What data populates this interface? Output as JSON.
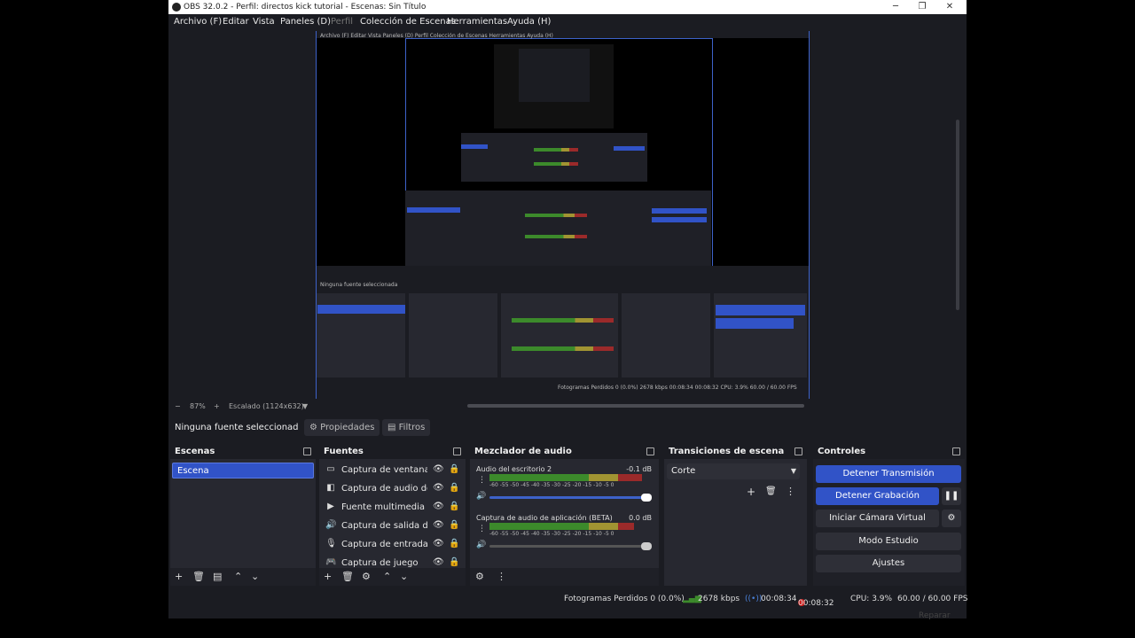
{
  "window": {
    "title": "OBS 32.0.2 - Perfil: directos kick tutorial - Escenas: Sin Título"
  },
  "menu": [
    {
      "label": "Archivo (F)",
      "enabled": true
    },
    {
      "label": "Editar",
      "enabled": true
    },
    {
      "label": "Vista",
      "enabled": true
    },
    {
      "label": "Paneles (D)",
      "enabled": true
    },
    {
      "label": "Perfil",
      "enabled": false
    },
    {
      "label": "Colección de Escenas",
      "enabled": true
    },
    {
      "label": "Herramientas",
      "enabled": true
    },
    {
      "label": "Ayuda (H)",
      "enabled": true
    }
  ],
  "zoombar": {
    "zoom": "87%",
    "scale": "Escalado (1124x632)"
  },
  "propbar": {
    "source_label": "Ninguna fuente seleccionad",
    "properties": "Propiedades",
    "filters": "Filtros"
  },
  "docks": {
    "scenes": {
      "title": "Escenas",
      "items": [
        "Escena"
      ]
    },
    "sources": {
      "title": "Fuentes",
      "items": [
        {
          "icon": "window-icon",
          "label": "Captura de ventana"
        },
        {
          "icon": "audio-input-icon",
          "label": "Captura de audio de aplicación"
        },
        {
          "icon": "play-icon",
          "label": "Fuente multimedia"
        },
        {
          "icon": "speaker-icon",
          "label": "Captura de salida de audio"
        },
        {
          "icon": "microphone-icon",
          "label": "Captura de entrada de audio"
        },
        {
          "icon": "gamepad-icon",
          "label": "Captura de juego"
        }
      ]
    },
    "mixer": {
      "title": "Mezclador de audio",
      "channels": [
        {
          "name": "Audio del escritorio 2",
          "db": "-0.1 dB",
          "level": 0.95,
          "fader": 1.0
        },
        {
          "name": "Captura de audio de aplicación (BETA)",
          "db": "0.0 dB",
          "level": 0.9,
          "fader": 1.0
        }
      ],
      "ticks": [
        "-60",
        "-55",
        "-50",
        "-45",
        "-40",
        "-35",
        "-30",
        "-25",
        "-20",
        "-15",
        "-10",
        "-5",
        "0"
      ]
    },
    "transitions": {
      "title": "Transiciones de escena",
      "selected": "Corte"
    },
    "controls": {
      "title": "Controles",
      "stop_stream": "Detener Transmisión",
      "stop_record": "Detener Grabación",
      "virtual_cam": "Iniciar Cámara Virtual",
      "studio_mode": "Modo Estudio",
      "settings": "Ajustes"
    }
  },
  "status": {
    "dropped": "Fotogramas Perdidos 0 (0.0%)",
    "bitrate": "2678 kbps",
    "stream_time": "00:08:34",
    "record_time": "00:08:32",
    "cpu": "CPU: 3.9%",
    "fps": "60.00 / 60.00 FPS"
  },
  "watermark": "Reparar",
  "colors": {
    "accent": "#3153c7",
    "meter_green": "#3c8a2b",
    "meter_yellow": "#a19432",
    "meter_red": "#9b2a2a",
    "rec": "#d0201e"
  }
}
